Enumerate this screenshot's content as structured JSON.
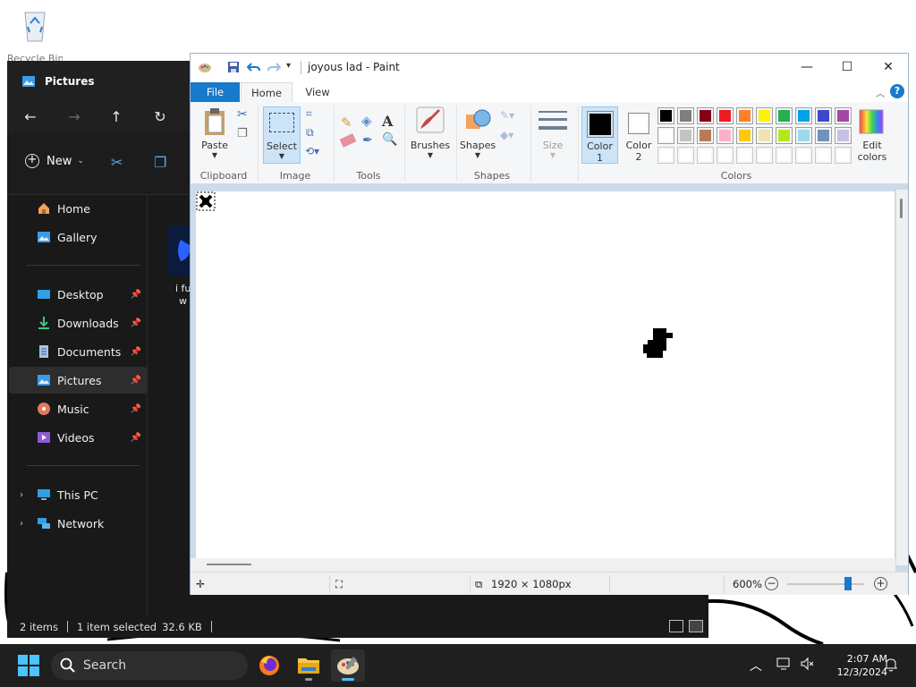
{
  "desktop": {
    "recycle_bin_label": "Recycle Bin"
  },
  "explorer": {
    "tab_title": "Pictures",
    "toolbar": {
      "new_label": "New"
    },
    "sidebar": {
      "home": "Home",
      "gallery": "Gallery",
      "desktop": "Desktop",
      "downloads": "Downloads",
      "documents": "Documents",
      "pictures": "Pictures",
      "music": "Music",
      "videos": "Videos",
      "this_pc": "This PC",
      "network": "Network"
    },
    "file": {
      "name_line1": "i fu",
      "name_line2": "w"
    },
    "status": {
      "items": "2 items",
      "selected": "1 item selected",
      "size": "32.6 KB"
    }
  },
  "paint": {
    "title": "joyous lad - Paint",
    "tabs": {
      "file": "File",
      "home": "Home",
      "view": "View"
    },
    "help": "?",
    "ribbon": {
      "paste": "Paste",
      "select": "Select",
      "brushes": "Brushes",
      "shapes": "Shapes",
      "size": "Size",
      "color1_line1": "Color",
      "color1_line2": "1",
      "color2_line1": "Color",
      "color2_line2": "2",
      "edit_colors_line1": "Edit",
      "edit_colors_line2": "colors",
      "groups": {
        "clipboard": "Clipboard",
        "image": "Image",
        "tools": "Tools",
        "shapes": "Shapes",
        "colors": "Colors"
      }
    },
    "palette": {
      "row1": [
        "#000000",
        "#7f7f7f",
        "#880015",
        "#ed1c24",
        "#ff7f27",
        "#fff200",
        "#22b14c",
        "#00a2e8",
        "#3f48cc",
        "#a349a4"
      ],
      "row2": [
        "#ffffff",
        "#c3c3c3",
        "#b97a57",
        "#ffaec9",
        "#ffc90e",
        "#efe4b0",
        "#b5e61d",
        "#99d9ea",
        "#7092be",
        "#c8bfe7"
      ],
      "row3": [
        "#ffffff",
        "#ffffff",
        "#ffffff",
        "#ffffff",
        "#ffffff",
        "#ffffff",
        "#ffffff",
        "#ffffff",
        "#ffffff",
        "#ffffff"
      ],
      "color1": "#000000",
      "color2": "#ffffff"
    },
    "status": {
      "dimensions": "1920 × 1080px",
      "zoom": "600%"
    }
  },
  "taskbar": {
    "search_label": "Search",
    "time": "2:07 AM",
    "date": "12/3/2024"
  }
}
